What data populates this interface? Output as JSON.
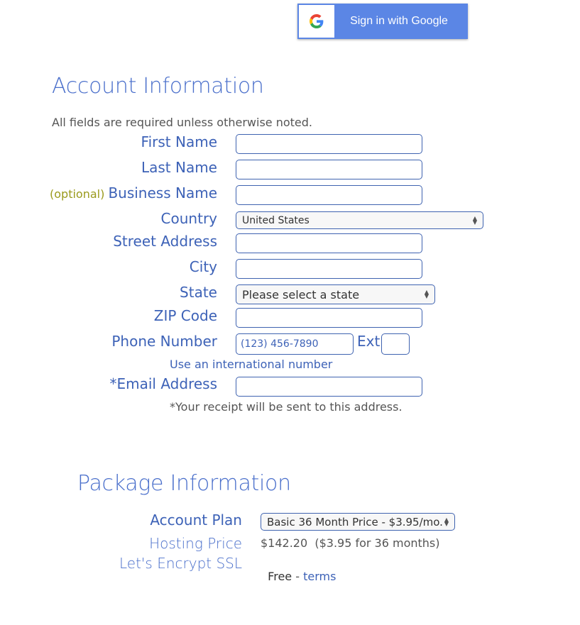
{
  "google_signin": {
    "label": "Sign in with Google",
    "icon": "google-g-icon",
    "brand_color": "#5b86e5"
  },
  "account": {
    "title": "Account Information",
    "note": "All fields are required unless otherwise noted.",
    "optional_tag": "(optional)",
    "fields": {
      "first_name": {
        "label": "First Name",
        "value": ""
      },
      "last_name": {
        "label": "Last Name",
        "value": ""
      },
      "business_name": {
        "label": "Business Name",
        "value": ""
      },
      "country": {
        "label": "Country",
        "selected": "United States"
      },
      "street": {
        "label": "Street Address",
        "value": ""
      },
      "city": {
        "label": "City",
        "value": ""
      },
      "state": {
        "label": "State",
        "selected": "Please select a state"
      },
      "zip": {
        "label": "ZIP Code",
        "value": ""
      },
      "phone": {
        "label": "Phone Number",
        "placeholder": "(123) 456-7890",
        "ext_label": "Ext",
        "ext_value": ""
      },
      "intl_link": "Use an international number",
      "email": {
        "label": "*Email Address",
        "value": ""
      },
      "email_note": "*Your receipt will be sent to this address."
    }
  },
  "package": {
    "title": "Package Information",
    "plan": {
      "label": "Account Plan",
      "selected": "Basic 36 Month Price - $3.95/mo."
    },
    "hosting": {
      "label": "Hosting Price",
      "value": "$142.20  ($3.95 for 36 months)"
    },
    "ssl": {
      "label": "Let's Encrypt SSL",
      "value": "Free",
      "sep": " - ",
      "link": "terms"
    }
  }
}
